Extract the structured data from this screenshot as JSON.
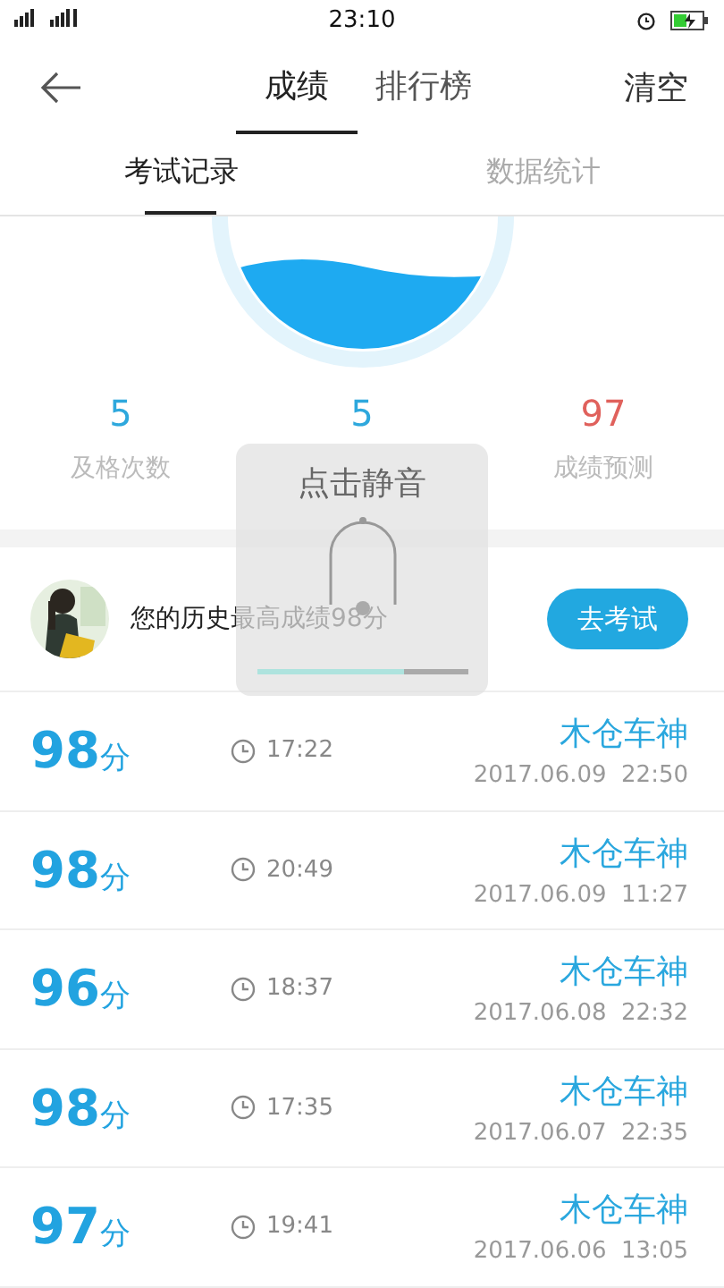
{
  "status_bar": {
    "time": "23:10"
  },
  "nav": {
    "tabs": [
      {
        "label": "成绩",
        "selected": true
      },
      {
        "label": "排行榜",
        "selected": false
      }
    ],
    "action": "清空"
  },
  "sub_tabs": [
    {
      "label": "考试记录",
      "selected": true
    },
    {
      "label": "数据统计",
      "selected": false
    }
  ],
  "stats": [
    {
      "value": "5",
      "label": "及格次数",
      "color": "#2ea8dd"
    },
    {
      "value": "5",
      "color": "#2ea8dd"
    },
    {
      "value": "97",
      "label": "成绩预测",
      "color": "#e0615c"
    }
  ],
  "best": {
    "text": "您的历史最高成绩98分",
    "button": "去考试"
  },
  "records": [
    {
      "score": "98",
      "unit": "分",
      "duration": "17:22",
      "name": "木仓车神",
      "date": "2017.06.09  22:50"
    },
    {
      "score": "98",
      "unit": "分",
      "duration": "20:49",
      "name": "木仓车神",
      "date": "2017.06.09  11:27"
    },
    {
      "score": "96",
      "unit": "分",
      "duration": "18:37",
      "name": "木仓车神",
      "date": "2017.06.08  22:32"
    },
    {
      "score": "98",
      "unit": "分",
      "duration": "17:35",
      "name": "木仓车神",
      "date": "2017.06.07  22:35"
    },
    {
      "score": "97",
      "unit": "分",
      "duration": "19:41",
      "name": "木仓车神",
      "date": "2017.06.06  13:05"
    }
  ],
  "toast": {
    "label": "点击静音",
    "level": 0.7
  }
}
